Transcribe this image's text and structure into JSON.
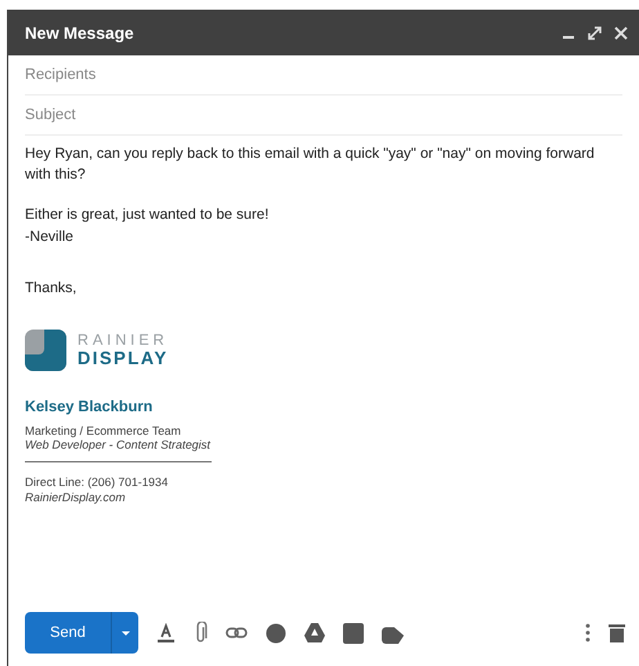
{
  "window": {
    "title": "New Message"
  },
  "fields": [
    {
      "placeholder": "Recipients"
    },
    {
      "placeholder": "Subject"
    }
  ],
  "body": {
    "paragraphs": [
      "Hey Ryan, can you reply back to this email with a quick \"yay\" or \"nay\" on moving forward with this?",
      "Either is great, just wanted to be sure!\n-Neville",
      "Thanks,"
    ]
  },
  "signature": {
    "logo_top": "RAINIER",
    "logo_bottom": "DISPLAY",
    "name": "Kelsey Blackburn",
    "team": "Marketing / Ecommerce Team",
    "role": "Web Developer - Content Strategist",
    "phone": "Direct Line: (206) 701-1934",
    "website": "RainierDisplay.com"
  },
  "toolbar": {
    "send": "Send"
  }
}
